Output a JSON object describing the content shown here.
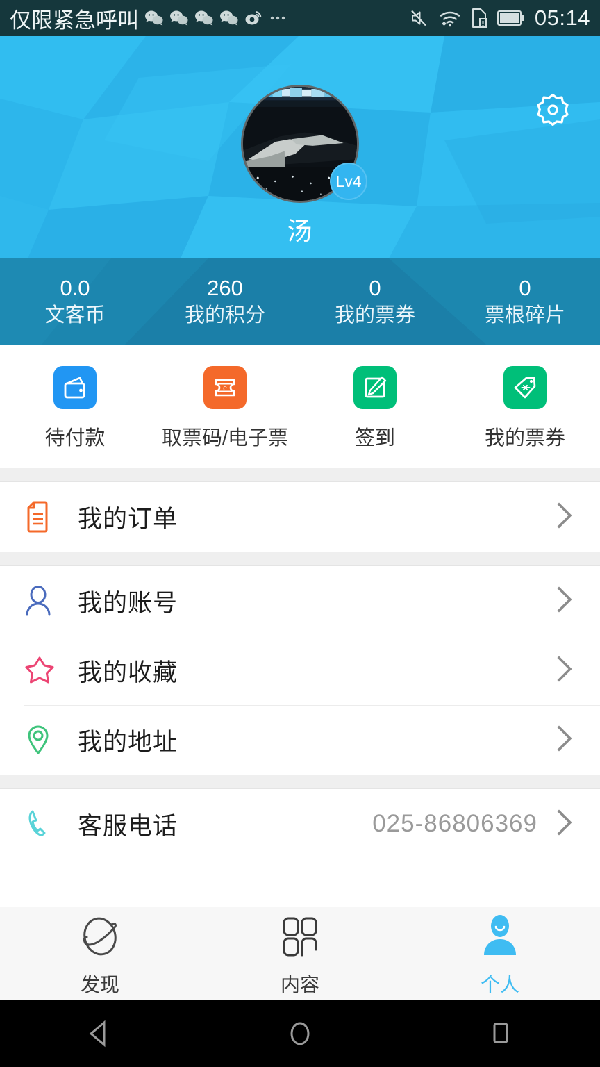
{
  "statusbar": {
    "carrier": "仅限紧急呼叫",
    "time": "05:14",
    "left_icons": [
      "wechat-icon",
      "wechat-icon",
      "wechat-icon",
      "wechat-icon",
      "weibo-icon",
      "more-ellipsis-icon"
    ],
    "right_icons": [
      "mute-icon",
      "wifi-icon",
      "sim-alert-icon",
      "battery-icon"
    ],
    "background_color": "#15373c"
  },
  "header": {
    "username": "汤",
    "level_badge": "Lv4",
    "settings_icon": "gear-icon",
    "avatar_icon": "avatar",
    "background_color": "#2cb8ec"
  },
  "stats": [
    {
      "value": "0.0",
      "label": "文客币"
    },
    {
      "value": "260",
      "label": "我的积分"
    },
    {
      "value": "0",
      "label": "我的票券"
    },
    {
      "value": "0",
      "label": "票根碎片"
    }
  ],
  "quick_actions": [
    {
      "label": "待付款",
      "icon": "wallet-icon",
      "color": "#2196f3"
    },
    {
      "label": "取票码/电子票",
      "icon": "eticket-icon",
      "color": "#f4692a"
    },
    {
      "label": "签到",
      "icon": "checkin-pencil-icon",
      "color": "#00bf79"
    },
    {
      "label": "我的票券",
      "icon": "coupon-tag-icon",
      "color": "#00bf79"
    }
  ],
  "menu_group_1": [
    {
      "label": "我的订单",
      "icon": "order-document-icon",
      "color": "#f4692a",
      "value": ""
    }
  ],
  "menu_group_2": [
    {
      "label": "我的账号",
      "icon": "person-outline-icon",
      "color": "#4a6bbd",
      "value": ""
    },
    {
      "label": "我的收藏",
      "icon": "star-outline-icon",
      "color": "#ec4473",
      "value": ""
    },
    {
      "label": "我的地址",
      "icon": "location-pin-icon",
      "color": "#3fc47c",
      "value": ""
    }
  ],
  "menu_group_3": [
    {
      "label": "客服电话",
      "icon": "phone-icon",
      "color": "#59d3d8",
      "value": "025-86806369"
    }
  ],
  "tabbar": [
    {
      "label": "发现",
      "icon": "compass-planet-icon",
      "active": false
    },
    {
      "label": "内容",
      "icon": "grid-squares-icon",
      "active": false
    },
    {
      "label": "个人",
      "icon": "person-filled-icon",
      "active": true
    }
  ],
  "navbar": [
    {
      "icon": "back-triangle-icon"
    },
    {
      "icon": "home-circle-icon"
    },
    {
      "icon": "recents-square-icon"
    }
  ],
  "colors": {
    "accent": "#3fbcf2",
    "header": "#2cb8ec",
    "stats_band": "#1b7fa6",
    "separator": "#efefef"
  }
}
